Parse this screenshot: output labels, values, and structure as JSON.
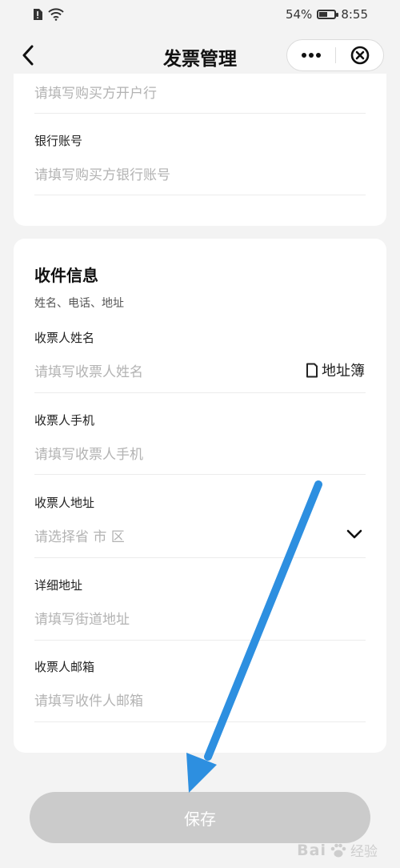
{
  "status_bar": {
    "battery_percent": "54%",
    "battery_level": 0.54,
    "time": "8:55",
    "icons": [
      "sim-alert-icon",
      "wifi-icon",
      "battery-icon"
    ]
  },
  "nav": {
    "title": "发票管理",
    "icons": [
      "back-arrow-icon",
      "more-dots-icon",
      "close-circle-icon"
    ]
  },
  "buyer_section": {
    "bank_placeholder": "请填写购买方开户行",
    "account_label": "银行账号",
    "account_placeholder": "请填写购买方银行账号"
  },
  "receiver_section": {
    "title": "收件信息",
    "subtitle": "姓名、电话、地址",
    "name_label": "收票人姓名",
    "name_placeholder": "请填写收票人姓名",
    "address_book": "地址簿",
    "phone_label": "收票人手机",
    "phone_placeholder": "请填写收票人手机",
    "region_label": "收票人地址",
    "region_placeholder": "请选择省 市 区",
    "detail_label": "详细地址",
    "detail_placeholder": "请填写街道地址",
    "email_label": "收票人邮箱",
    "email_placeholder": "请填写收件人邮箱"
  },
  "actions": {
    "save_label": "保存"
  },
  "annotation": {
    "arrow_color": "#2d8fe0"
  },
  "watermark": {
    "text": "Bai",
    "suffix": "经验"
  }
}
